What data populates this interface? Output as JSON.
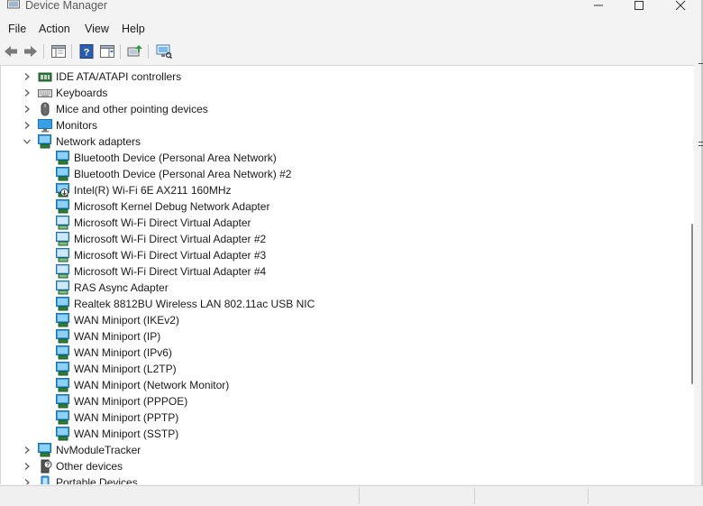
{
  "window": {
    "title": "Device Manager"
  },
  "menu": [
    "File",
    "Action",
    "View",
    "Help"
  ],
  "toolbar": {
    "buttons": [
      "back-icon",
      "forward-icon",
      "properties-icon",
      "help-icon",
      "show-hide-console-tree-icon",
      "update-driver-icon",
      "scan-hardware-icon"
    ]
  },
  "tree": {
    "categories_top": [
      {
        "label": "IDE ATA/ATAPI controllers",
        "icon": "ide-controller-icon",
        "expanded": false
      },
      {
        "label": "Keyboards",
        "icon": "keyboard-icon",
        "expanded": false
      },
      {
        "label": "Mice and other pointing devices",
        "icon": "mouse-icon",
        "expanded": false
      },
      {
        "label": "Monitors",
        "icon": "monitor-icon",
        "expanded": false
      },
      {
        "label": "Network adapters",
        "icon": "network-adapter-icon",
        "expanded": true
      }
    ],
    "network_adapters": [
      "Bluetooth Device (Personal Area Network)",
      "Bluetooth Device (Personal Area Network) #2",
      "Intel(R) Wi-Fi 6E AX211 160MHz",
      "Microsoft Kernel Debug Network Adapter",
      "Microsoft Wi-Fi Direct Virtual Adapter",
      "Microsoft Wi-Fi Direct Virtual Adapter #2",
      "Microsoft Wi-Fi Direct Virtual Adapter #3",
      "Microsoft Wi-Fi Direct Virtual Adapter #4",
      "RAS Async Adapter",
      "Realtek 8812BU Wireless LAN 802.11ac USB NIC",
      "WAN Miniport (IKEv2)",
      "WAN Miniport (IP)",
      "WAN Miniport (IPv6)",
      "WAN Miniport (L2TP)",
      "WAN Miniport (Network Monitor)",
      "WAN Miniport (PPPOE)",
      "WAN Miniport (PPTP)",
      "WAN Miniport (SSTP)"
    ],
    "categories_bottom": [
      {
        "label": "NvModuleTracker",
        "icon": "network-adapter-icon",
        "expanded": false
      },
      {
        "label": "Other devices",
        "icon": "other-devices-icon",
        "expanded": false
      },
      {
        "label": "Portable Devices",
        "icon": "portable-device-icon",
        "expanded": false
      }
    ]
  },
  "colors": {
    "accent": "#1e86d8",
    "tree_bg": "#ffffff",
    "chrome_bg": "#f3f3f3"
  }
}
